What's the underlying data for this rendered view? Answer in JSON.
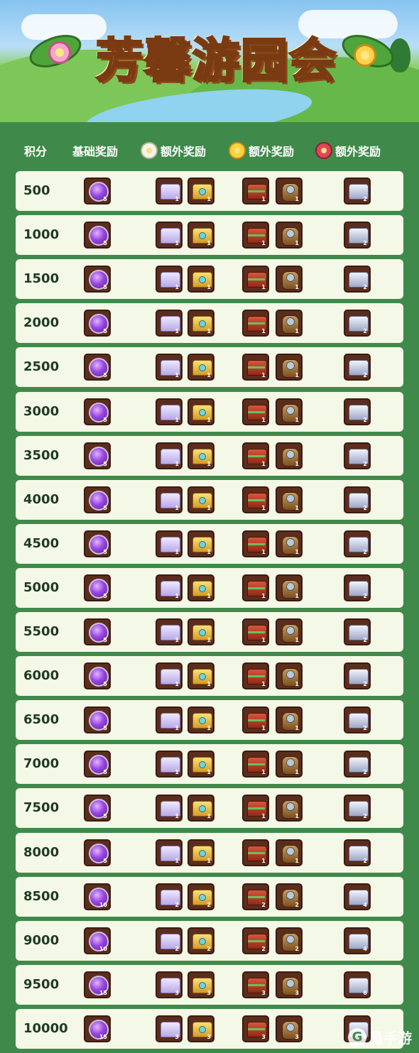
{
  "banner": {
    "title": "芳馨游园会"
  },
  "header": {
    "score": "积分",
    "base": "基础奖励",
    "extra_white": "额外奖励",
    "extra_yellow": "额外奖励",
    "extra_red": "额外奖励"
  },
  "icons": {
    "base": "purple-gem-icon",
    "white_1": "white-chest-icon",
    "white_2": "gold-chest-icon",
    "yellow_1": "red-chest-icon",
    "yellow_2": "leather-bag-icon",
    "red": "silver-chest-icon"
  },
  "rows": [
    {
      "score": "500",
      "base": "5",
      "white": [
        "1",
        "1"
      ],
      "yellow": [
        "1",
        "1"
      ],
      "red": "2"
    },
    {
      "score": "1000",
      "base": "5",
      "white": [
        "1",
        "1"
      ],
      "yellow": [
        "1",
        "1"
      ],
      "red": "2"
    },
    {
      "score": "1500",
      "base": "5",
      "white": [
        "1",
        "1"
      ],
      "yellow": [
        "1",
        "1"
      ],
      "red": "2"
    },
    {
      "score": "2000",
      "base": "5",
      "white": [
        "1",
        "1"
      ],
      "yellow": [
        "1",
        "1"
      ],
      "red": "2"
    },
    {
      "score": "2500",
      "base": "5",
      "white": [
        "1",
        "1"
      ],
      "yellow": [
        "1",
        "1"
      ],
      "red": "2"
    },
    {
      "score": "3000",
      "base": "5",
      "white": [
        "1",
        "1"
      ],
      "yellow": [
        "1",
        "1"
      ],
      "red": "2"
    },
    {
      "score": "3500",
      "base": "5",
      "white": [
        "1",
        "1"
      ],
      "yellow": [
        "1",
        "1"
      ],
      "red": "2"
    },
    {
      "score": "4000",
      "base": "5",
      "white": [
        "1",
        "1"
      ],
      "yellow": [
        "1",
        "1"
      ],
      "red": "2"
    },
    {
      "score": "4500",
      "base": "5",
      "white": [
        "1",
        "1"
      ],
      "yellow": [
        "1",
        "1"
      ],
      "red": "2"
    },
    {
      "score": "5000",
      "base": "5",
      "white": [
        "1",
        "1"
      ],
      "yellow": [
        "1",
        "1"
      ],
      "red": "2"
    },
    {
      "score": "5500",
      "base": "5",
      "white": [
        "1",
        "1"
      ],
      "yellow": [
        "1",
        "1"
      ],
      "red": "2"
    },
    {
      "score": "6000",
      "base": "5",
      "white": [
        "1",
        "1"
      ],
      "yellow": [
        "1",
        "1"
      ],
      "red": "2"
    },
    {
      "score": "6500",
      "base": "5",
      "white": [
        "1",
        "1"
      ],
      "yellow": [
        "1",
        "1"
      ],
      "red": "2"
    },
    {
      "score": "7000",
      "base": "5",
      "white": [
        "1",
        "1"
      ],
      "yellow": [
        "1",
        "1"
      ],
      "red": "2"
    },
    {
      "score": "7500",
      "base": "5",
      "white": [
        "1",
        "1"
      ],
      "yellow": [
        "1",
        "1"
      ],
      "red": "2"
    },
    {
      "score": "8000",
      "base": "5",
      "white": [
        "1",
        "1"
      ],
      "yellow": [
        "1",
        "1"
      ],
      "red": "2"
    },
    {
      "score": "8500",
      "base": "10",
      "white": [
        "2",
        "2"
      ],
      "yellow": [
        "2",
        "2"
      ],
      "red": "4"
    },
    {
      "score": "9000",
      "base": "10",
      "white": [
        "2",
        "2"
      ],
      "yellow": [
        "2",
        "2"
      ],
      "red": "4"
    },
    {
      "score": "9500",
      "base": "15",
      "white": [
        "3",
        "3"
      ],
      "yellow": [
        "3",
        "3"
      ],
      "red": "6"
    },
    {
      "score": "10000",
      "base": "15",
      "white": [
        "3",
        "3"
      ],
      "yellow": [
        "3",
        "3"
      ],
      "red": "6"
    }
  ],
  "watermark": {
    "text": "昌手游",
    "badge": "G"
  }
}
